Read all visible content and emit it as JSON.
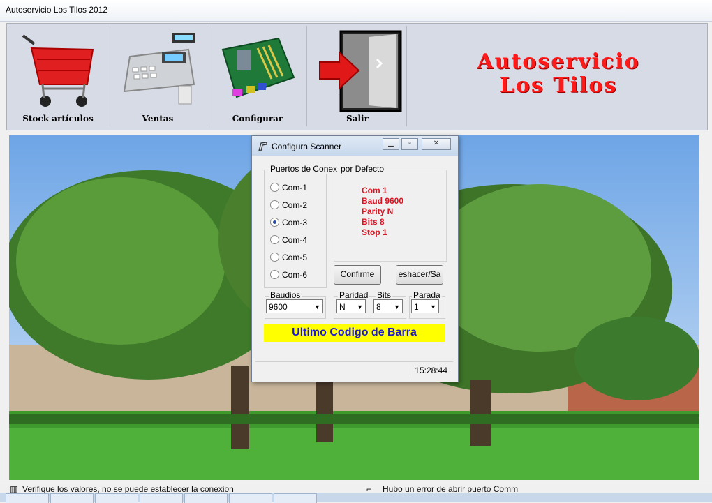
{
  "window": {
    "title": "Autoservicio Los Tilos 2012"
  },
  "toolbar": {
    "buttons": [
      {
        "label": "Stock artículos",
        "icon": "shopping-cart-icon"
      },
      {
        "label": "Ventas",
        "icon": "cash-register-icon"
      },
      {
        "label": "Configurar",
        "icon": "motherboard-icon"
      },
      {
        "label": "Salir",
        "icon": "exit-door-icon"
      }
    ],
    "brand_line1": "Autoservicio",
    "brand_line2": "Los Tilos"
  },
  "dialog": {
    "title": "Configura Scanner",
    "ports_group_label": "Puertos de Conex",
    "defaults_group_label": "por Defecto",
    "ports": [
      {
        "label": "Com-1",
        "selected": false
      },
      {
        "label": "Com-2",
        "selected": false
      },
      {
        "label": "Com-3",
        "selected": true
      },
      {
        "label": "Com-4",
        "selected": false
      },
      {
        "label": "Com-5",
        "selected": false
      },
      {
        "label": "Com-6",
        "selected": false
      }
    ],
    "defaults": [
      "Com 1",
      "Baud 9600",
      "Parity N",
      "Bits 8",
      "Stop 1"
    ],
    "confirm_label": "Confirme",
    "undo_label": "eshacer/Sa",
    "baud_label": "Baudios",
    "baud_value": "9600",
    "parity_label": "Paridad",
    "parity_value": "N",
    "bits_label": "Bits",
    "bits_value": "8",
    "stop_label": "Parada",
    "stop_value": "1",
    "barcode_label": "Ultimo Codigo de Barra",
    "clock": "15:28:44"
  },
  "statusbar": {
    "left": "Verifique los valores, no se puede establecer la conexion",
    "right": "Hubo un error de abrir puerto Comm"
  },
  "colors": {
    "brand": "#ff1a1a",
    "barcode_bg": "#ffff00",
    "barcode_text": "#1a18c8",
    "defaults_text": "#e01020"
  }
}
